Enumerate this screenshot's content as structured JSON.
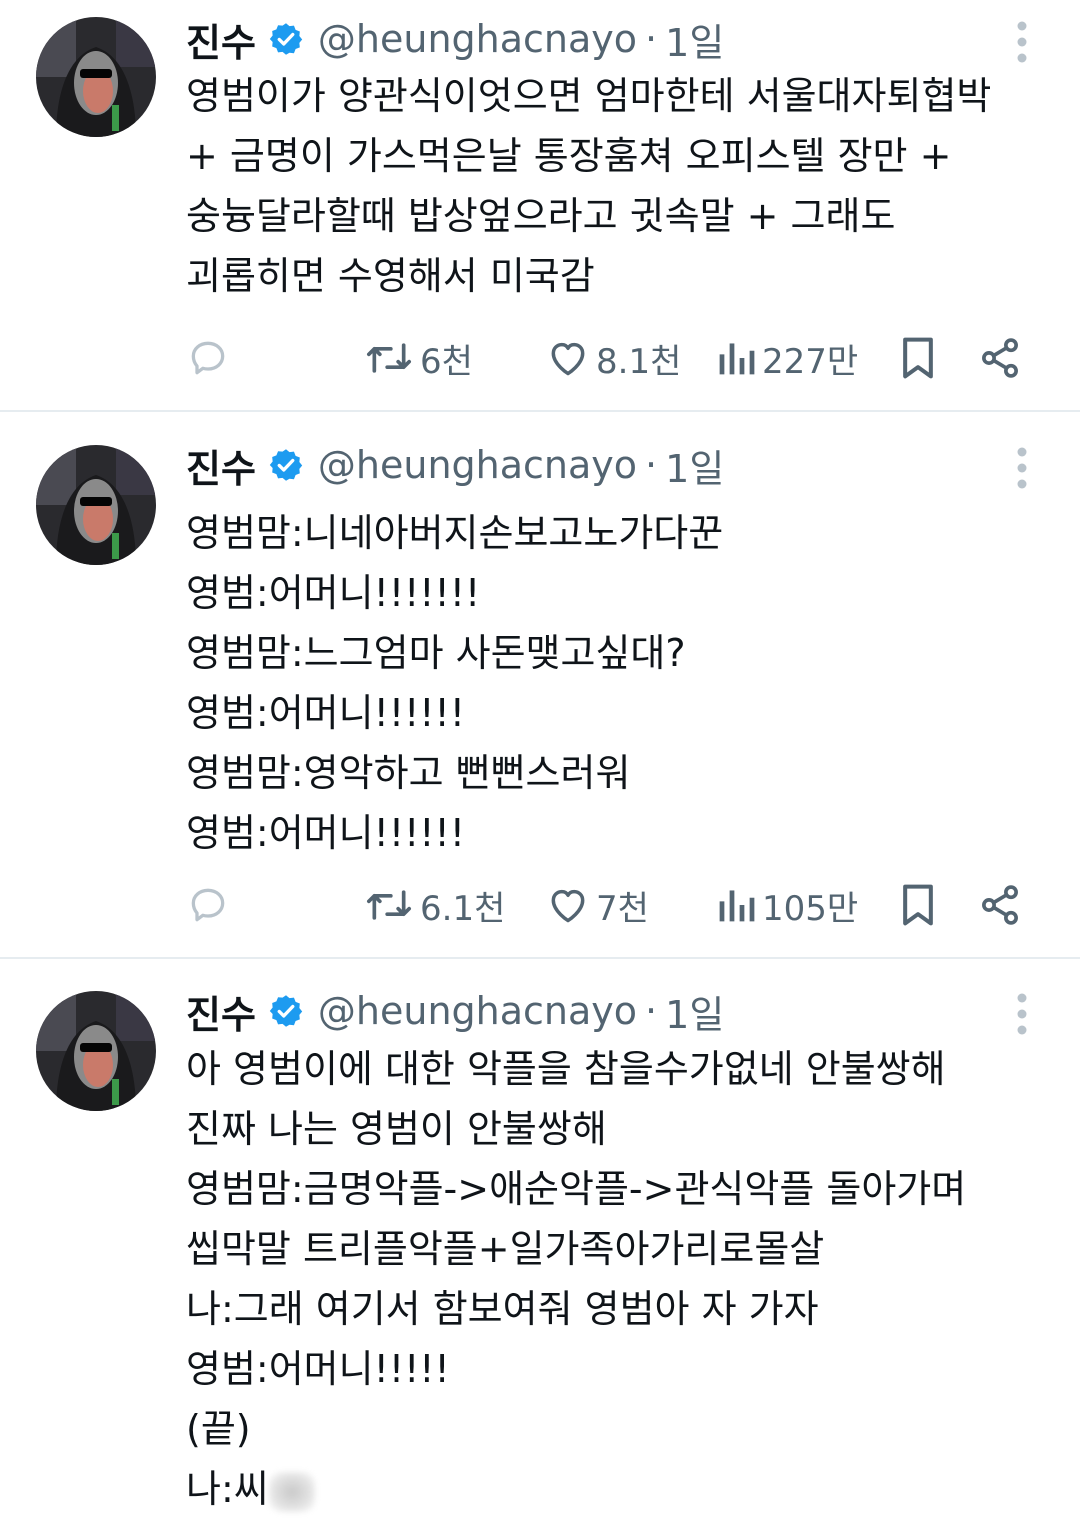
{
  "tweets": [
    {
      "name": "진수",
      "handle": "@heunghacnayo",
      "separator": "·",
      "time": "1일",
      "lines": [
        "영범이가 양관식이엇으면 엄마한테 서울대자퇴협박",
        "+ 금명이 가스먹은날 통장훔쳐 오피스텔 장만 +",
        "숭늉달라할때 밥상엎으라고 귓속말 + 그래도",
        "괴롭히면 수영해서 미국감"
      ],
      "retweets": "6천",
      "likes": "8.1천",
      "views": "227만"
    },
    {
      "name": "진수",
      "handle": "@heunghacnayo",
      "separator": "·",
      "time": "1일",
      "lines": [
        "영범맘:니네아버지손보고노가다꾼",
        "영범:어머니!!!!!!!",
        "영범맘:느그엄마 사돈맺고싶대?",
        "영범:어머니!!!!!!",
        "영범맘:영악하고 뻔뻔스러워",
        "영범:어머니!!!!!!"
      ],
      "retweets": "6.1천",
      "likes": "7천",
      "views": "105만"
    },
    {
      "name": "진수",
      "handle": "@heunghacnayo",
      "separator": "·",
      "time": "1일",
      "lines": [
        "아 영범이에 대한 악플을 참을수가없네 안불쌍해",
        "진짜 나는 영범이 안불쌍해",
        "영범맘:금명악플->애순악플->관식악플 돌아가며",
        "씹막말 트리플악플+일가족아가리로몰살",
        "나:그래 여기서 함보여줘 영범아 자 가자",
        "영범:어머니!!!!!",
        "(끝)",
        "나:씨"
      ]
    }
  ],
  "colors": {
    "verified": "#1d9bf0",
    "secondary_text": "#536471",
    "divider": "#e6ecf0"
  },
  "icons": [
    "reply-icon",
    "retweet-icon",
    "like-icon",
    "views-icon",
    "bookmark-icon",
    "share-icon",
    "more-icon",
    "verified-badge-icon"
  ]
}
